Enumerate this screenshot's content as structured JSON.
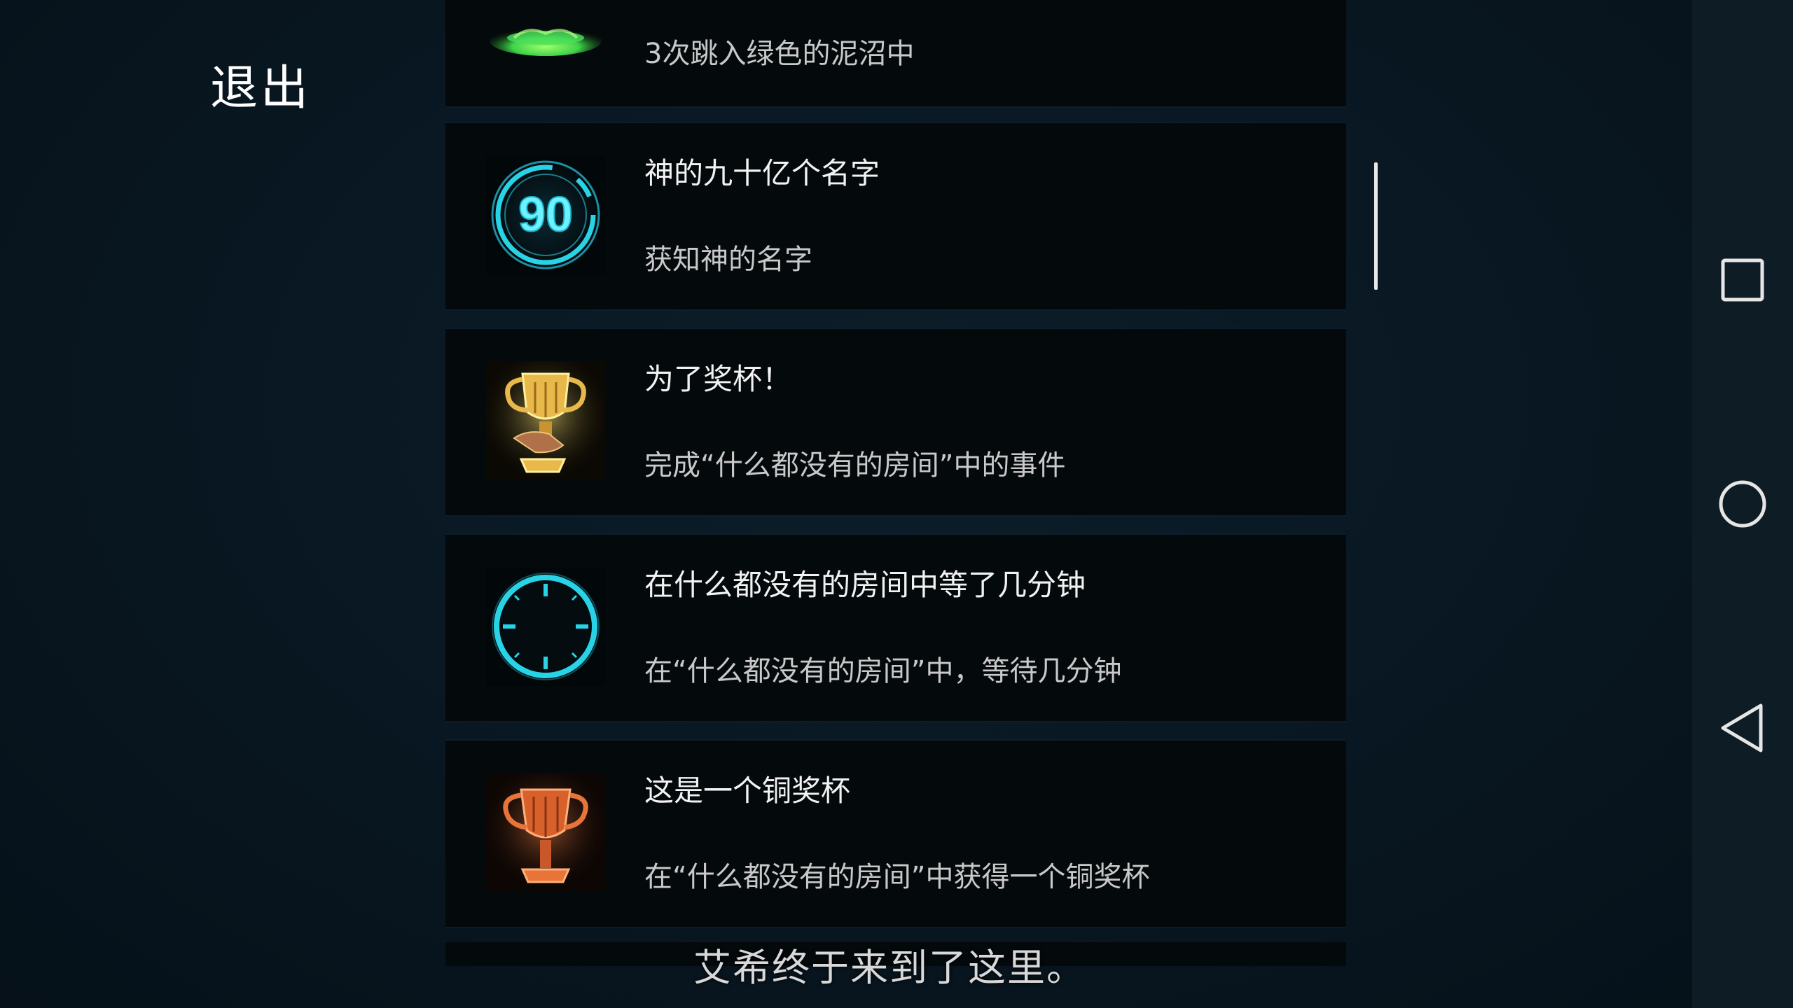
{
  "header": {
    "exit_label": "退出"
  },
  "achievements": [
    {
      "icon": "green-swamp-icon",
      "title": "",
      "desc": "3次跳入绿色的泥沼中"
    },
    {
      "icon": "ninety-badge-icon",
      "badge_text": "90",
      "title": "神的九十亿个名字",
      "desc": "获知神的名字"
    },
    {
      "icon": "gold-trophy-hand-icon",
      "title": "为了奖杯！",
      "desc": "完成“什么都没有的房间”中的事件"
    },
    {
      "icon": "clock-icon",
      "title": "在什么都没有的房间中等了几分钟",
      "desc": "在“什么都没有的房间”中，等待几分钟"
    },
    {
      "icon": "bronze-trophy-icon",
      "title": "这是一个铜奖杯",
      "desc": "在“什么都没有的房间”中获得一个铜奖杯"
    }
  ],
  "subtitle": "艾希终于来到了这里。",
  "navbar": {
    "recents_icon": "square-icon",
    "home_icon": "circle-icon",
    "back_icon": "triangle-back-icon"
  },
  "colors": {
    "background": "#081620",
    "card": "#04090c",
    "cyan_accent": "#29d3e6",
    "gold": "#e8b84a",
    "bronze": "#e8743a",
    "green": "#3fd24a"
  }
}
